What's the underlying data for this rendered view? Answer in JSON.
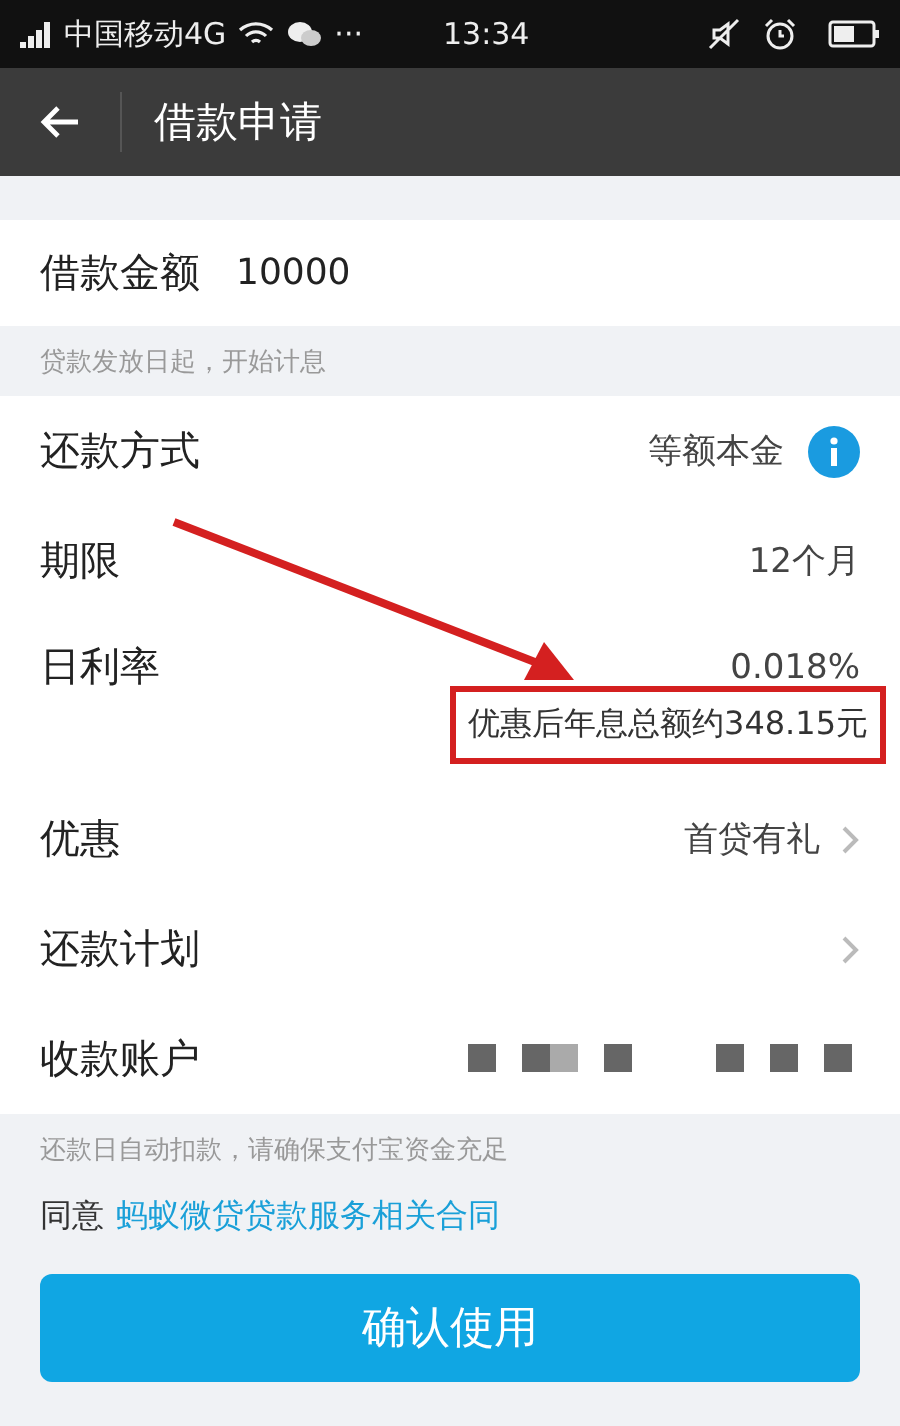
{
  "status_bar": {
    "carrier": "中国移动4G",
    "more": "···",
    "time": "13:34"
  },
  "header": {
    "title": "借款申请"
  },
  "amount": {
    "label": "借款金额",
    "value": "10000"
  },
  "amount_hint": "贷款发放日起，开始计息",
  "rows": [
    {
      "kind": "info",
      "label": "还款方式",
      "value": "等额本金"
    },
    {
      "kind": "plain",
      "label": "期限",
      "value": "12个月"
    },
    {
      "kind": "noted",
      "label": "日利率",
      "value": "0.018%",
      "note": "优惠后年息总额约348.15元"
    },
    {
      "kind": "link",
      "label": "优惠",
      "value": "首贷有礼"
    },
    {
      "kind": "link",
      "label": "还款计划"
    },
    {
      "kind": "redacted",
      "label": "收款账户"
    }
  ],
  "notice": "还款日自动扣款，请确保支付宝资金充足",
  "agreement": {
    "prefix": "同意",
    "link": "蚂蚁微贷贷款服务相关合同"
  },
  "button": "确认使用"
}
